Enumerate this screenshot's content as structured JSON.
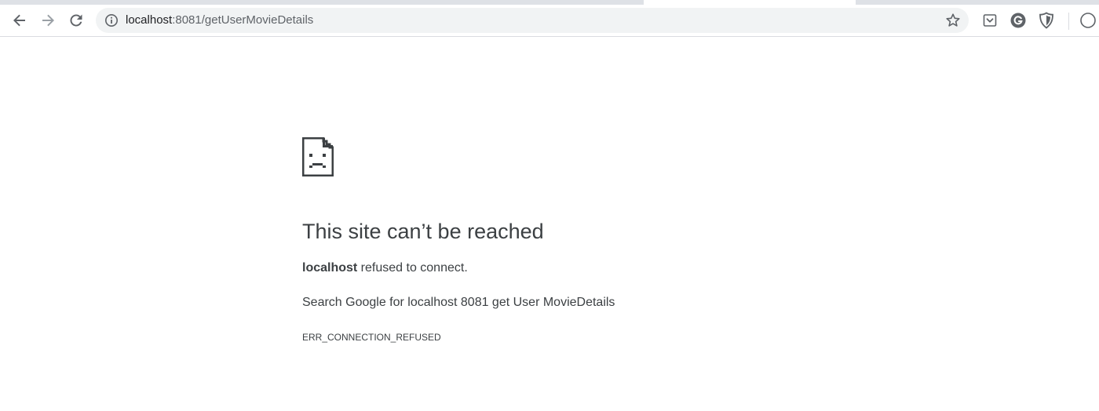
{
  "browser": {
    "url_host": "localhost",
    "url_rest": ":8081/getUserMovieDetails",
    "icons": {
      "back": "back-arrow-icon",
      "forward": "forward-arrow-icon",
      "reload": "reload-icon",
      "site_info": "info-icon",
      "bookmark": "star-icon",
      "extensions": [
        "pocket-icon",
        "grammarly-icon",
        "shield-icon"
      ],
      "menu": "kebab-menu-icon"
    },
    "colors": {
      "omnibox_bg": "#f1f3f4",
      "icon": "#5f6368",
      "icon_disabled": "#9aa0a6"
    }
  },
  "error_page": {
    "icon": "sad-page-icon",
    "title": "This site can’t be reached",
    "host_bold": "localhost",
    "description_rest": " refused to connect.",
    "search_prefix": "Search Google for ",
    "search_query": "localhost 8081 get User MovieDetails",
    "error_code": "ERR_CONNECTION_REFUSED",
    "text_color": "#3c4043"
  }
}
